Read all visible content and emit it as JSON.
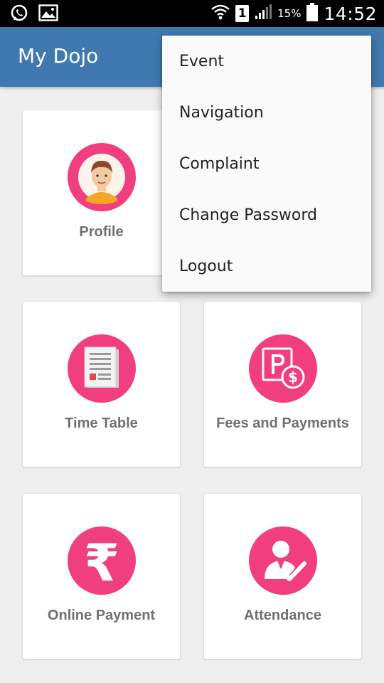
{
  "status_bar": {
    "icons_left": [
      "whatsapp-icon",
      "gallery-icon"
    ],
    "sim_slot": "1",
    "battery_percent": "15%",
    "time": "14:52"
  },
  "app_bar": {
    "title": "My Dojo"
  },
  "tiles": [
    {
      "label": "Profile",
      "icon": "profile-avatar-icon"
    },
    {
      "label": "Time Table",
      "icon": "document-icon"
    },
    {
      "label": "Fees and Payments",
      "icon": "parking-payment-icon"
    },
    {
      "label": "Online Payment",
      "icon": "rupee-icon"
    },
    {
      "label": "Attendance",
      "icon": "user-check-icon"
    }
  ],
  "menu": {
    "items": [
      "Event",
      "Navigation",
      "Complaint",
      "Change Password",
      "Logout"
    ]
  },
  "colors": {
    "app_bar": "#3f79b0",
    "accent_pink": "#f03e7e",
    "background": "#efefef"
  }
}
